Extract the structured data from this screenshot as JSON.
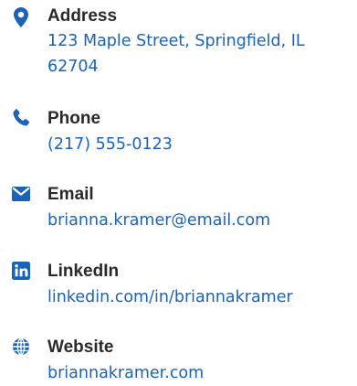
{
  "contacts": [
    {
      "icon": "map-pin-icon",
      "label": "Address",
      "value": "123 Maple Street, Springfield, IL 62704"
    },
    {
      "icon": "phone-icon",
      "label": "Phone",
      "value": "(217) 555-0123"
    },
    {
      "icon": "envelope-icon",
      "label": "Email",
      "value": "brianna.kramer@email.com"
    },
    {
      "icon": "linkedin-icon",
      "label": "LinkedIn",
      "value": "linkedin.com/in/briannakramer"
    },
    {
      "icon": "globe-icon",
      "label": "Website",
      "value": "briannakramer.com"
    }
  ],
  "colors": {
    "accent": "#1a63b8",
    "label": "#2a2a2a"
  }
}
